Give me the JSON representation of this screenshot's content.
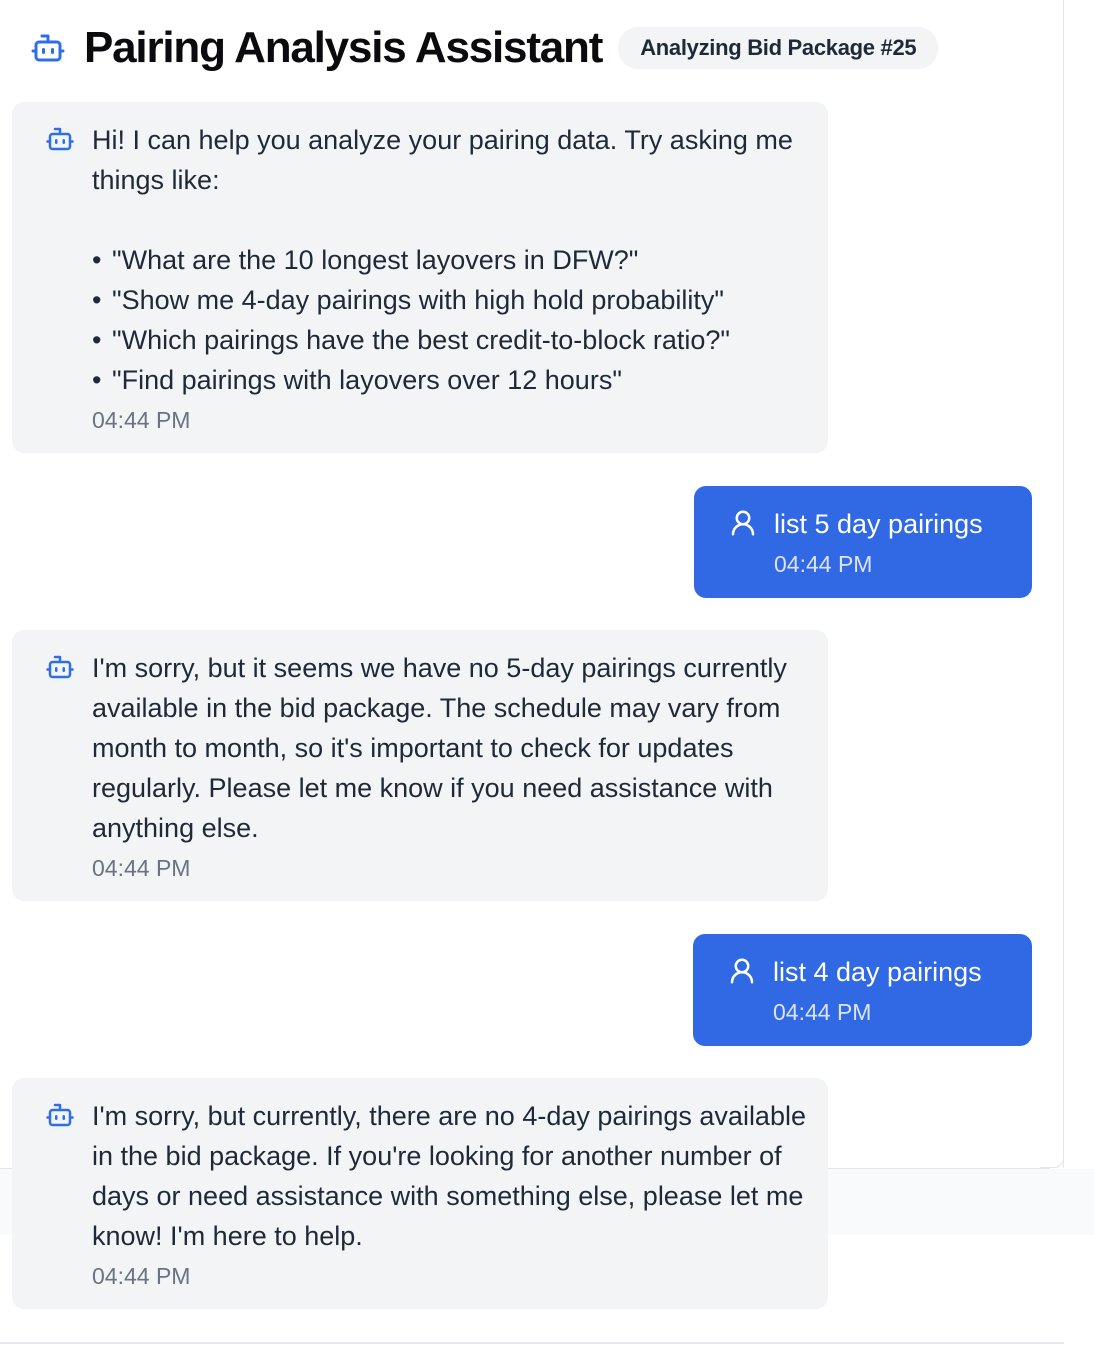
{
  "header": {
    "title": "Pairing Analysis Assistant",
    "badge": "Analyzing Bid Package #25",
    "icon": "robot-icon"
  },
  "messages": [
    {
      "role": "assistant",
      "icon": "robot-icon",
      "text": "Hi! I can help you analyze your pairing data. Try asking me things like:",
      "bullets": [
        "\"What are the 10 longest layovers in DFW?\"",
        "\"Show me 4-day pairings with high hold probability\"",
        "\"Which pairings have the best credit-to-block ratio?\"",
        "\"Find pairings with layovers over 12 hours\""
      ],
      "time": "04:44 PM"
    },
    {
      "role": "user",
      "icon": "user-icon",
      "text": "list 5 day pairings",
      "time": "04:44 PM"
    },
    {
      "role": "assistant",
      "icon": "robot-icon",
      "text": "I'm sorry, but it seems we have no 5-day pairings currently available in the bid package. The schedule may vary from month to month, so it's important to check for updates regularly. Please let me know if you need assistance with anything else.",
      "time": "04:44 PM"
    },
    {
      "role": "user",
      "icon": "user-icon",
      "text": "list 4 day pairings",
      "time": "04:44 PM"
    },
    {
      "role": "assistant",
      "icon": "robot-icon",
      "text": "I'm sorry, but currently, there are no 4-day pairings available in the bid package. If you're looking for another number of days or need assistance with something else, please let me know! I'm here to help.",
      "time": "04:44 PM"
    }
  ],
  "colors": {
    "accent": "#3168e3",
    "bot_bubble": "#f3f4f6",
    "icon_blue": "#2f6fe4",
    "timestamp": "#6b7280"
  }
}
